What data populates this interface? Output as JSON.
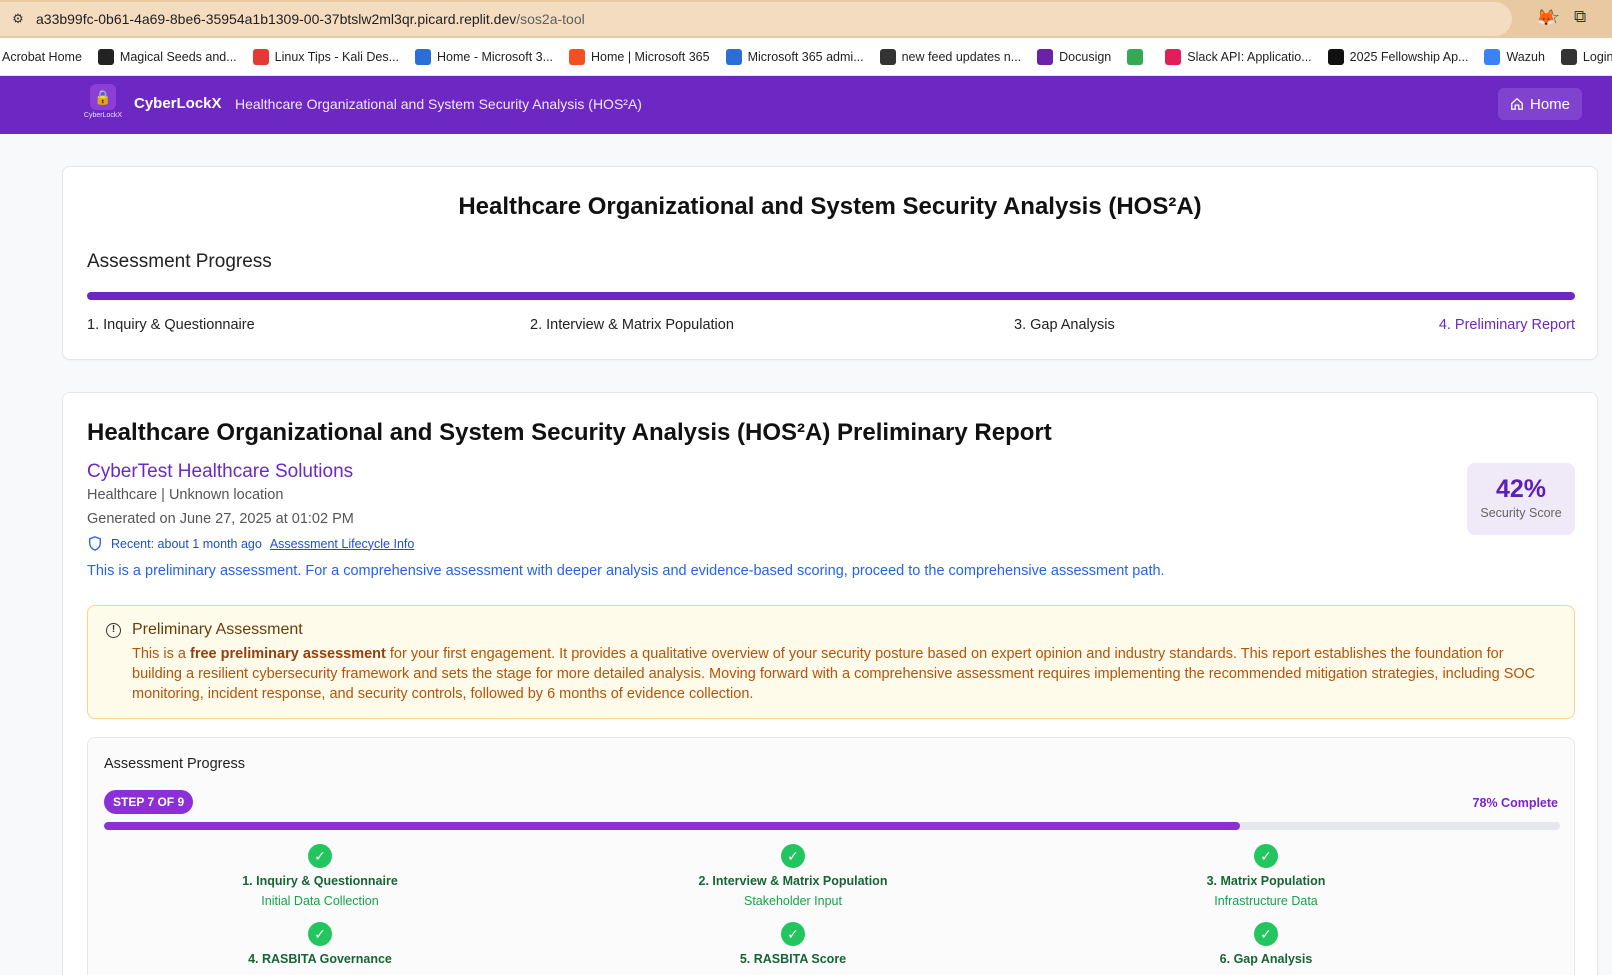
{
  "browser": {
    "url_host": "a33b99fc-0b61-4a69-8be6-35954a1b1309-00-37btslw2ml3qr.picard.replit.dev",
    "url_path": "/sos2a-tool",
    "bookmarks": [
      {
        "label": "Acrobat Home",
        "color": ""
      },
      {
        "label": "Magical Seeds and...",
        "color": "#222"
      },
      {
        "label": "Linux Tips - Kali Des...",
        "color": "#e53935"
      },
      {
        "label": "Home - Microsoft 3...",
        "color": "#2b6fd6"
      },
      {
        "label": "Home | Microsoft 365",
        "color": "#f25022"
      },
      {
        "label": "Microsoft 365 admi...",
        "color": "#2b6fd6"
      },
      {
        "label": "new feed updates n...",
        "color": "#333"
      },
      {
        "label": "Docusign",
        "color": "#6b21a8"
      },
      {
        "label": "",
        "color": "#34a853"
      },
      {
        "label": "Slack API: Applicatio...",
        "color": "#e01e5a"
      },
      {
        "label": "2025 Fellowship Ap...",
        "color": "#111"
      },
      {
        "label": "Wazuh",
        "color": "#3b82f6"
      },
      {
        "label": "Login Page",
        "color": "#333"
      }
    ]
  },
  "app": {
    "logo_text": "CyberLockX",
    "brand": "CyberLockX",
    "title": "Healthcare Organizational and System Security Analysis (HOS²A)",
    "home_label": "Home"
  },
  "progress_card": {
    "title": "Healthcare Organizational and System Security Analysis (HOS²A)",
    "subtitle": "Assessment Progress",
    "steps": [
      "1. Inquiry & Questionnaire",
      "2. Interview & Matrix Population",
      "3. Gap Analysis",
      "4. Preliminary Report"
    ],
    "active_step": 4
  },
  "report": {
    "title": "Healthcare Organizational and System Security Analysis (HOS²A) Preliminary Report",
    "org_name": "CyberTest Healthcare Solutions",
    "org_meta": "Healthcare | Unknown location",
    "generated": "Generated on June 27, 2025 at 01:02 PM",
    "recent": "Recent: about 1 month ago",
    "lifecycle_link": "Assessment Lifecycle Info",
    "note": "This is a preliminary assessment. For a comprehensive assessment with deeper analysis and evidence-based scoring, proceed to the comprehensive assessment path.",
    "score_value": "42%",
    "score_label": "Security Score"
  },
  "warning": {
    "title": "Preliminary Assessment",
    "body_prefix": "This is a ",
    "body_bold": "free preliminary assessment",
    "body_suffix": " for your first engagement. It provides a qualitative overview of your security posture based on expert opinion and industry standards. This report establishes the foundation for building a resilient cybersecurity framework and sets the stage for more detailed analysis. Moving forward with a comprehensive assessment requires implementing the recommended mitigation strategies, including SOC monitoring, incident response, and security controls, followed by 6 months of evidence collection."
  },
  "tracker": {
    "title": "Assessment Progress",
    "badge": "STEP 7 OF 9",
    "percent_label": "78% Complete",
    "percent": 78,
    "steps": [
      {
        "name": "1. Inquiry & Questionnaire",
        "sub": "Initial Data Collection"
      },
      {
        "name": "2. Interview & Matrix Population",
        "sub": "Stakeholder Input"
      },
      {
        "name": "3. Matrix Population",
        "sub": "Infrastructure Data"
      },
      {
        "name": "4. RASBITA Governance",
        "sub": ""
      },
      {
        "name": "5. RASBITA Score",
        "sub": ""
      },
      {
        "name": "6. Gap Analysis",
        "sub": ""
      }
    ],
    "check_glyph": "✓"
  }
}
